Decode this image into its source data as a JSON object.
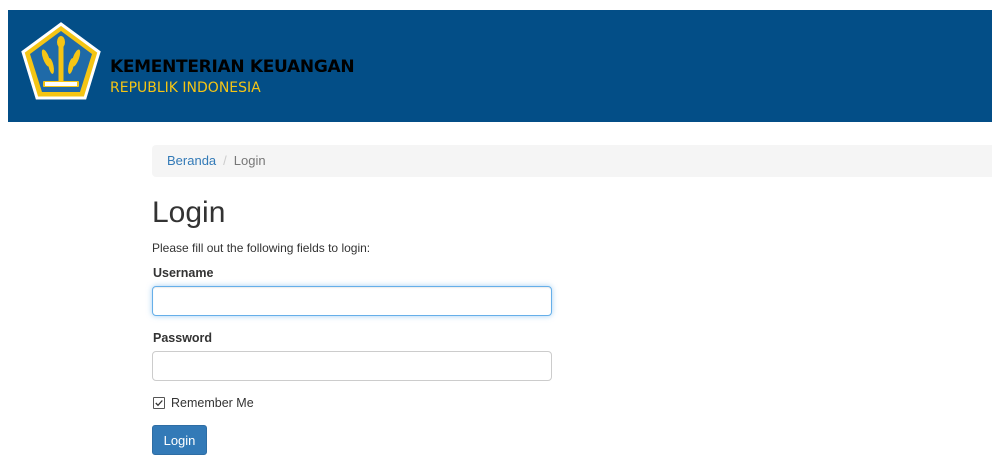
{
  "header": {
    "title": "KEMENTERIAN KEUANGAN",
    "subtitle": "REPUBLIK INDONESIA",
    "logo_icon": "kemenkeu-emblem-icon",
    "colors": {
      "banner": "#034e87",
      "subtitle": "#f5c514"
    }
  },
  "breadcrumb": {
    "home": "Beranda",
    "separator": "/",
    "current": "Login"
  },
  "main": {
    "title": "Login",
    "intro": "Please fill out the following fields to login:",
    "username": {
      "label": "Username",
      "value": "",
      "placeholder": ""
    },
    "password": {
      "label": "Password",
      "value": "",
      "placeholder": ""
    },
    "remember": {
      "label": "Remember Me",
      "checked": true
    },
    "submit_label": "Login",
    "colors": {
      "accent": "#337ab7"
    }
  }
}
